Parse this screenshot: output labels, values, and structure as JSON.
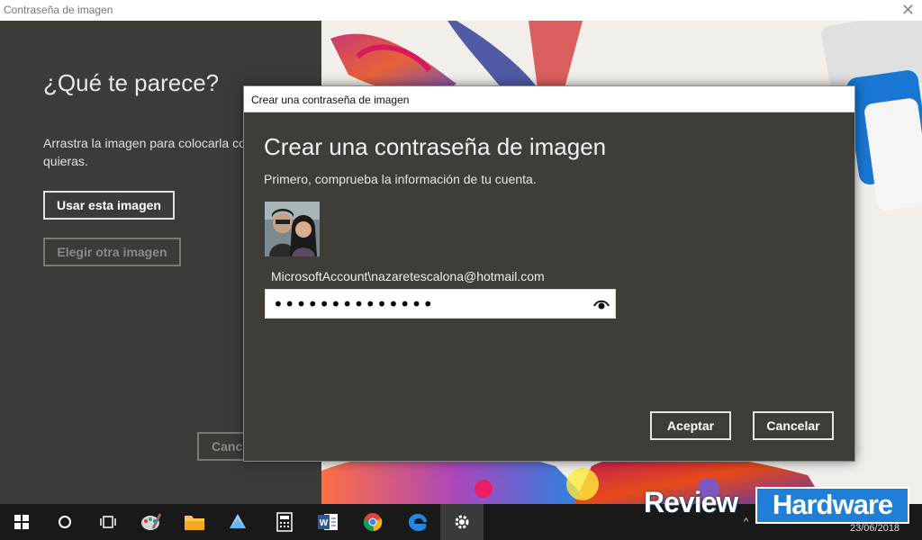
{
  "window": {
    "title": "Contraseña de imagen",
    "close_glyph": "✕"
  },
  "left_pane": {
    "heading": "¿Qué te parece?",
    "description": "Arrastra la imagen para colocarla co quieras.",
    "use_image_label": "Usar esta imagen",
    "choose_other_label": "Elegir otra imagen",
    "cancel_label": "Canc"
  },
  "dialog": {
    "titlebar": "Crear una contraseña de imagen",
    "heading": "Crear una contraseña de imagen",
    "subheading": "Primero, comprueba la información de tu cuenta.",
    "account": "MicrosoftAccount\\nazaretescalona@hotmail.com",
    "password_value": "••••••••••••••",
    "accept_label": "Aceptar",
    "cancel_label": "Cancelar"
  },
  "taskbar": {
    "items": [
      "windows-start",
      "cortana",
      "task-view",
      "paint",
      "file-explorer",
      "mail-app",
      "calculator",
      "word",
      "chrome",
      "edge",
      "settings"
    ],
    "active": "settings",
    "clock_date": "23/06/2018"
  },
  "watermark": {
    "part1": "Review",
    "part2": "Hardware"
  },
  "colors": {
    "dialog_bg": "#403d39",
    "left_bg": "#3c3b38",
    "taskbar_bg": "#191919",
    "accent_blue": "#1f7fd6"
  }
}
